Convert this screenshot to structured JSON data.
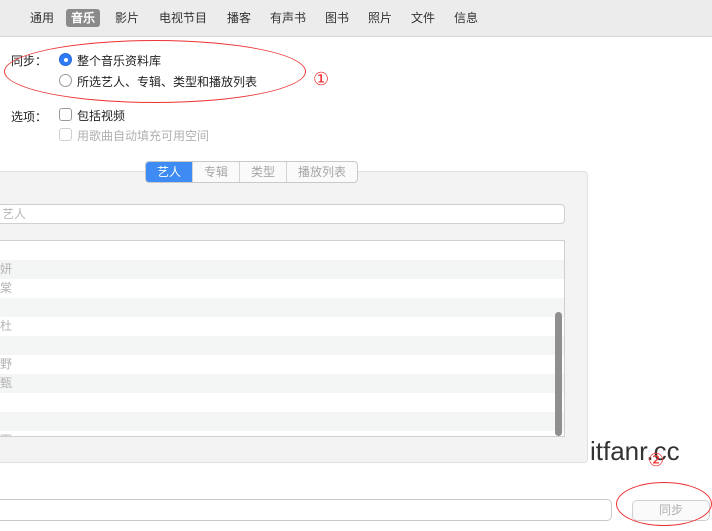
{
  "tabs": [
    {
      "label": "通用",
      "active": false
    },
    {
      "label": "音乐",
      "active": true
    },
    {
      "label": "影片",
      "active": false
    },
    {
      "label": "电视节目",
      "active": false
    },
    {
      "label": "播客",
      "active": false
    },
    {
      "label": "有声书",
      "active": false
    },
    {
      "label": "图书",
      "active": false
    },
    {
      "label": "照片",
      "active": false
    },
    {
      "label": "文件",
      "active": false
    },
    {
      "label": "信息",
      "active": false
    }
  ],
  "sync_section": {
    "label": "同步：",
    "options": [
      {
        "label": "整个音乐资料库",
        "selected": true
      },
      {
        "label": "所选艺人、专辑、类型和播放列表",
        "selected": false
      }
    ]
  },
  "options_section": {
    "label": "选项：",
    "checkboxes": [
      {
        "label": "包括视频",
        "checked": false,
        "enabled": true
      },
      {
        "label": "用歌曲自动填充可用空间",
        "checked": false,
        "enabled": false
      }
    ]
  },
  "segments": [
    {
      "label": "艺人",
      "active": true
    },
    {
      "label": "专辑",
      "active": false
    },
    {
      "label": "类型",
      "active": false
    },
    {
      "label": "播放列表",
      "active": false
    }
  ],
  "search": {
    "placeholder": "艺人"
  },
  "artist_rows": [
    "",
    "妍",
    "棠",
    "",
    "杜",
    "",
    "野",
    "甄",
    "",
    "",
    "雨"
  ],
  "annotations": {
    "marker1": "①",
    "marker2": "②"
  },
  "watermark": "itfanr.cc",
  "sync_button": "同步",
  "colors": {
    "accent": "#2f7bf6",
    "annotation": "#e33333"
  }
}
